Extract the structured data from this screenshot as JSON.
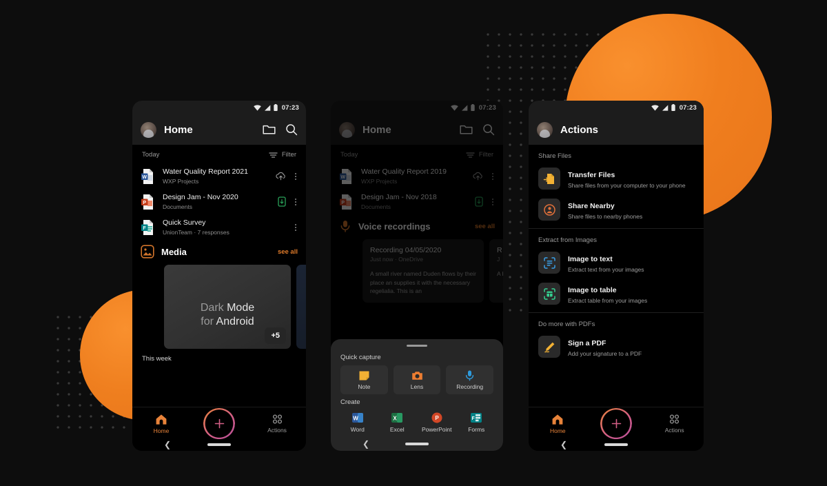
{
  "status_bar": {
    "time": "07:23",
    "icons": [
      "wifi-icon",
      "signal-icon",
      "battery-icon"
    ]
  },
  "colors": {
    "accent_orange": "#e8833a",
    "fab_pink": "#d45f86",
    "background": "#0d0d0d",
    "surface": "#1c1c1c"
  },
  "phone_home": {
    "appbar": {
      "title": "Home",
      "folder_icon": "folder-icon",
      "search_icon": "search-icon",
      "avatar": "user-avatar"
    },
    "section": {
      "label": "Today",
      "filter_label": "Filter",
      "filter_icon": "filter-icon"
    },
    "files": [
      {
        "title": "Water Quality Report 2021",
        "subtitle": "WXP Projects",
        "icon": "word-file-icon",
        "trail_icon": "cloud-upload-icon"
      },
      {
        "title": "Design Jam - Nov 2020",
        "subtitle": "Documents",
        "icon": "powerpoint-file-icon",
        "trail_icon": "offline-available-icon"
      },
      {
        "title": "Quick Survey",
        "subtitle": "UnionTeam · 7 responses",
        "icon": "forms-file-icon",
        "trail_icon": ""
      }
    ],
    "media": {
      "title": "Media",
      "icon": "image-icon",
      "see_all": "see all",
      "card_line1_dim": "Dark ",
      "card_line1": "Mode",
      "card_line2_dim": "for ",
      "card_line2": "Android",
      "more_badge": "+5"
    },
    "this_week": "This week",
    "bottom_nav": {
      "home_label": "Home",
      "actions_label": "Actions",
      "home_icon": "home-icon",
      "actions_icon": "grid-dots-icon",
      "fab_icon": "plus-icon"
    }
  },
  "phone_capture": {
    "appbar": {
      "title": "Home",
      "folder_icon": "folder-icon",
      "search_icon": "search-icon",
      "avatar": "user-avatar"
    },
    "section": {
      "label": "Today",
      "filter_label": "Filter",
      "filter_icon": "filter-icon"
    },
    "files": [
      {
        "title": "Water Quality Report 2019",
        "subtitle": "WXP Projects",
        "icon": "word-file-icon",
        "trail_icon": "cloud-upload-icon"
      },
      {
        "title": "Design Jam - Nov 2018",
        "subtitle": "Documents",
        "icon": "powerpoint-file-icon",
        "trail_icon": "offline-available-icon"
      }
    ],
    "voice": {
      "title": "Voice recordings",
      "icon": "microphone-icon",
      "see_all": "see all"
    },
    "recordings": [
      {
        "title": "Recording 04/05/2020",
        "subtitle": "Just now · OneDrive",
        "body": "A small  river named Duden flows by their place an  supplies it with the necessary regelialia. This is an"
      },
      {
        "title": "R",
        "subtitle": "J",
        "body": "A b th"
      }
    ],
    "sheet": {
      "quick_capture_label": "Quick capture",
      "quick_capture": [
        {
          "label": "Note",
          "icon": "sticky-note-icon"
        },
        {
          "label": "Lens",
          "icon": "camera-icon"
        },
        {
          "label": "Recording",
          "icon": "microphone-icon"
        }
      ],
      "create_label": "Create",
      "create": [
        {
          "label": "Word",
          "icon": "word-app-icon"
        },
        {
          "label": "Excel",
          "icon": "excel-app-icon"
        },
        {
          "label": "PowerPoint",
          "icon": "powerpoint-app-icon"
        },
        {
          "label": "Forms",
          "icon": "forms-app-icon"
        }
      ]
    }
  },
  "phone_actions": {
    "appbar": {
      "title": "Actions",
      "avatar": "user-avatar"
    },
    "sections": [
      {
        "label": "Share Files",
        "items": [
          {
            "title": "Transfer Files",
            "subtitle": "Share files from your computer to your phone",
            "icon": "transfer-files-icon"
          },
          {
            "title": "Share Nearby",
            "subtitle": "Share files to nearby phones",
            "icon": "share-nearby-icon"
          }
        ]
      },
      {
        "label": "Extract from Images",
        "items": [
          {
            "title": "Image to text",
            "subtitle": "Extract text from your images",
            "icon": "scan-text-icon"
          },
          {
            "title": "Image to table",
            "subtitle": "Extract table from your images",
            "icon": "scan-table-icon"
          }
        ]
      },
      {
        "label": "Do more with PDFs",
        "items": [
          {
            "title": "Sign a PDF",
            "subtitle": "Add your signature to a PDF",
            "icon": "signature-pen-icon"
          }
        ]
      }
    ],
    "bottom_nav": {
      "home_label": "Home",
      "actions_label": "Actions",
      "home_icon": "home-icon",
      "actions_icon": "grid-dots-icon",
      "fab_icon": "plus-icon"
    }
  }
}
